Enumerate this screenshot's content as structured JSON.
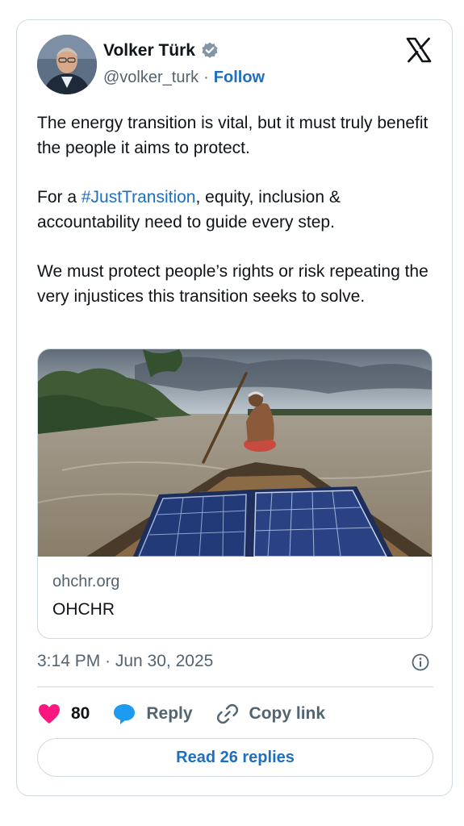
{
  "author": {
    "name": "Volker Türk",
    "handle": "@volker_turk",
    "separator": "·",
    "follow_label": "Follow",
    "verified_icon": "verified-badge-icon"
  },
  "tweet": {
    "paragraph1": "The energy transition is vital, but it must truly benefit the people it aims to protect.",
    "p2_before": "For a ",
    "hashtag": "#JustTransition",
    "p2_after": ", equity, inclusion & accountability need to guide every step.",
    "paragraph3": "We must protect people’s rights or risk repeating the very injustices this transition seeks to solve."
  },
  "link_card": {
    "domain": "ohchr.org",
    "title": "OHCHR"
  },
  "timestamp": "3:14 PM · Jun 30, 2025",
  "actions": {
    "like_count": "80",
    "reply_label": "Reply",
    "copy_link_label": "Copy link"
  },
  "read_replies_label": "Read 26 replies",
  "colors": {
    "accent": "#1d6fc2",
    "like": "#f91880",
    "reply_bubble": "#1d9bf0",
    "muted": "#536471",
    "border": "#cfd9de"
  }
}
